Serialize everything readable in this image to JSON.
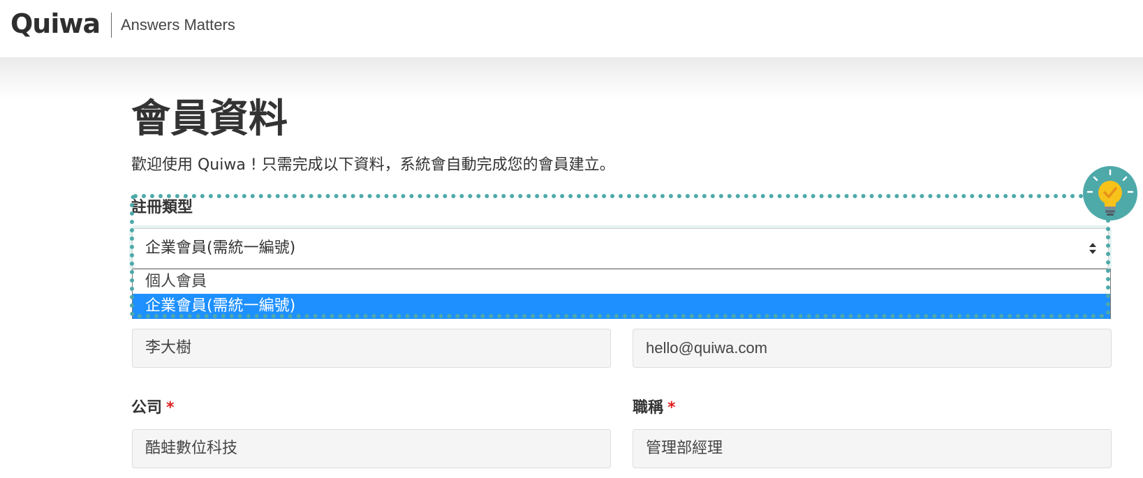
{
  "header": {
    "logo": "Quiwa",
    "tagline": "Answers Matters"
  },
  "page": {
    "title": "會員資料",
    "intro": "歡迎使用 Quiwa ! 只需完成以下資料，系統會自動完成您的會員建立。"
  },
  "registration": {
    "label": "註冊類型",
    "selected": "企業會員(需統一編號)",
    "options": [
      "個人會員",
      "企業會員(需統一編號)"
    ],
    "selected_index": 1
  },
  "fields": {
    "name_value": "李大樹",
    "email_value": "hello@quiwa.com",
    "company_label": "公司",
    "company_value": "酷蛙數位科技",
    "title_label": "職稱",
    "title_value": "管理部經理",
    "required_mark": "*"
  },
  "colors": {
    "accent_teal": "#4ea9a9",
    "selected_option": "#1e90ff",
    "required": "#e02020",
    "bulb": "#f7c21a"
  },
  "icons": {
    "tip": "lightbulb-check-icon",
    "select_arrows": "sort-arrows-icon"
  }
}
